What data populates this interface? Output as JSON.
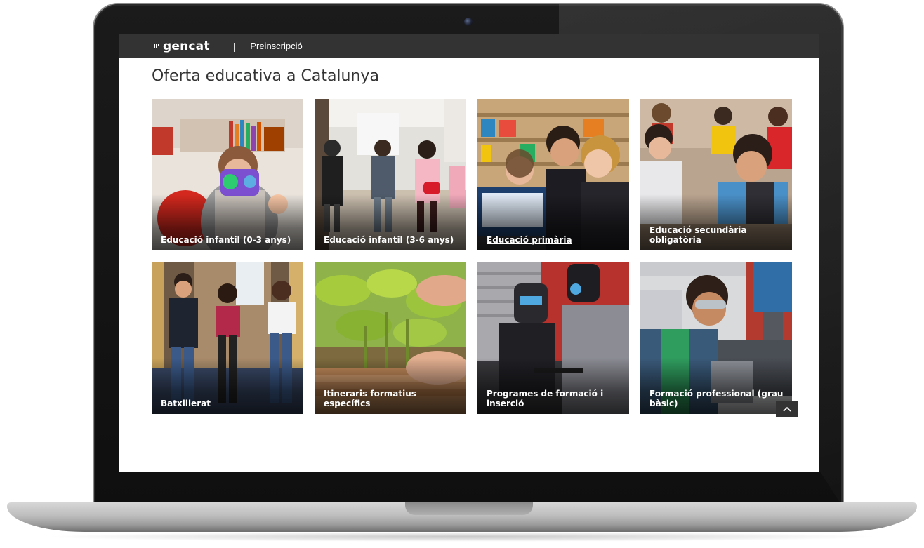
{
  "header": {
    "brand": "gencat",
    "divider": "|",
    "section": "Preinscripció"
  },
  "page": {
    "title": "Oferta educativa a Catalunya"
  },
  "cards": [
    {
      "label": "Educació infantil (0-3 anys)"
    },
    {
      "label": "Educació infantil (3-6 anys)"
    },
    {
      "label": "Educació primària"
    },
    {
      "label": "Educació secundària obligatòria"
    },
    {
      "label": "Batxillerat"
    },
    {
      "label": "Itineraris formatius específics"
    },
    {
      "label": "Programes de formació i inserció"
    },
    {
      "label": "Formació professional (grau bàsic)"
    }
  ],
  "icons": {
    "brand_mark": "gencat-logo-icon",
    "back_to_top": "chevron-up-icon"
  },
  "colors": {
    "header_bg": "#333333",
    "title_text": "#333333",
    "card_label": "#ffffff"
  }
}
